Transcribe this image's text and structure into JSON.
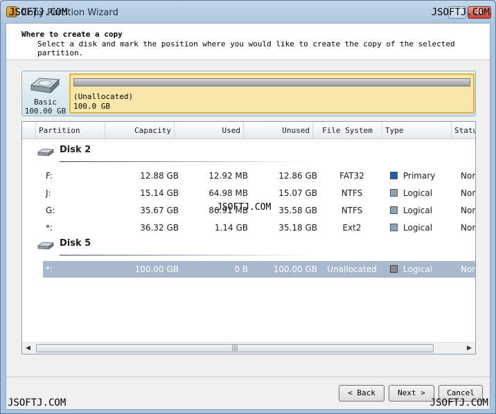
{
  "window": {
    "title": "Copy Partition Wizard",
    "close_glyph": "✕"
  },
  "watermark": "JSOFTJ.COM",
  "header": {
    "title": "Where to create a copy",
    "subtitle": "Select a disk and mark the position where you would like to create the copy of the selected partition."
  },
  "disk_map": {
    "disk_type": "Basic",
    "disk_size": "100.00 GB",
    "partition_label": "(Unallocated)",
    "partition_size": "100.0 GB"
  },
  "columns": [
    "Partition",
    "Capacity",
    "Used",
    "Unused",
    "File System",
    "Type",
    "Status"
  ],
  "groups": [
    {
      "name": "Disk 2",
      "rows": [
        {
          "partition": "F:",
          "capacity": "12.88 GB",
          "used": "12.92 MB",
          "unused": "12.86 GB",
          "fs": "FAT32",
          "type": "Primary",
          "status": "None"
        },
        {
          "partition": "J:",
          "capacity": "15.14 GB",
          "used": "64.98 MB",
          "unused": "15.07 GB",
          "fs": "NTFS",
          "type": "Logical",
          "status": "None"
        },
        {
          "partition": "G:",
          "capacity": "35.67 GB",
          "used": "86.91 MB",
          "unused": "35.58 GB",
          "fs": "NTFS",
          "type": "Logical",
          "status": "None"
        },
        {
          "partition": "*:",
          "capacity": "36.32 GB",
          "used": "1.14 GB",
          "unused": "35.18 GB",
          "fs": "Ext2",
          "type": "Logical",
          "status": "None"
        }
      ]
    },
    {
      "name": "Disk 5",
      "rows": [
        {
          "partition": "*:",
          "capacity": "100.00 GB",
          "used": "0 B",
          "unused": "100.00 GB",
          "fs": "Unallocated",
          "type": "Logical",
          "status": "None"
        }
      ]
    }
  ],
  "colors": {
    "primary_square": "#1f5fa8",
    "logical_square": "#8fa3b3",
    "selected_row": "#a9b8cd"
  },
  "scrollbar": {
    "left_arrow": "◀",
    "right_arrow": "▶",
    "grip": "|||"
  },
  "buttons": {
    "back": "< Back",
    "next": "Next >",
    "cancel": "Cancel"
  }
}
